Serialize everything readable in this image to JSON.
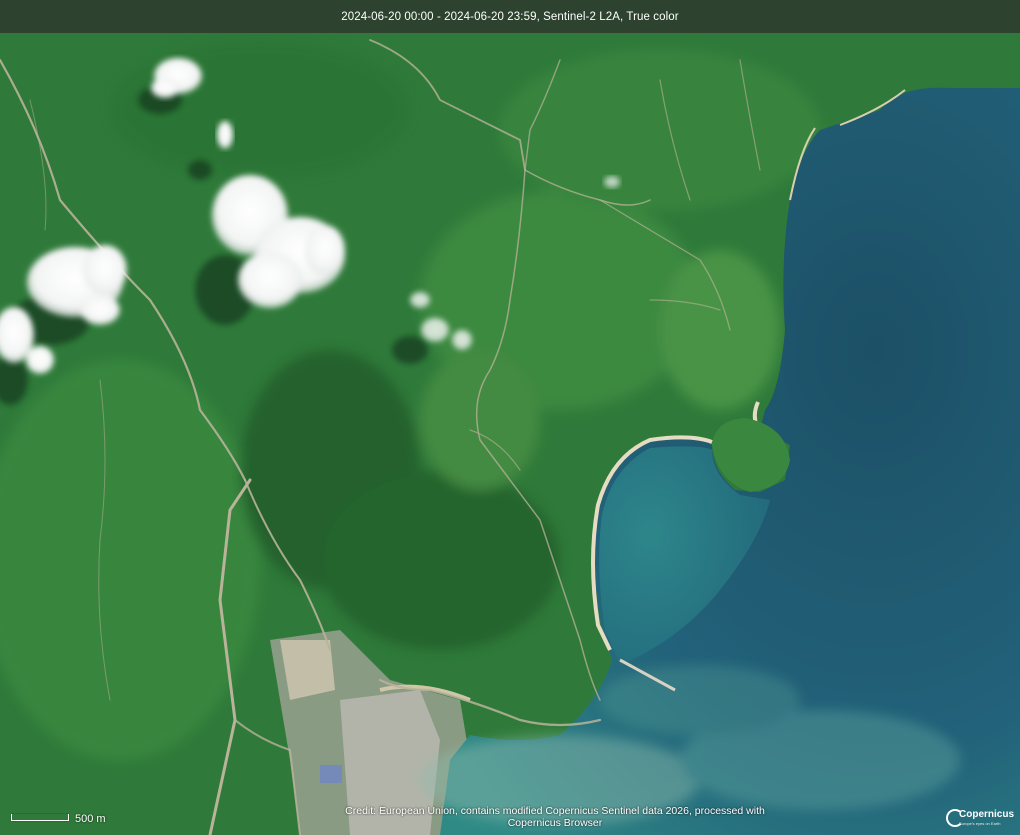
{
  "header": {
    "title": "2024-06-20 00:00 - 2024-06-20 23:59, Sentinel-2 L2A, True color"
  },
  "scale": {
    "label": "500 m"
  },
  "credit": {
    "line1": "Credit: European Union, contains modified Copernicus Sentinel data 2026, processed with",
    "line2": "Copernicus Browser"
  },
  "logo": {
    "text": "Copernicus",
    "sub": "Europe's eyes on Earth"
  },
  "colors": {
    "forest": "#2f7a3a",
    "forest_dark": "#245f2c",
    "forest_light": "#4a8f45",
    "sea_deep": "#1f5a6c",
    "sea_shallow": "#2a7e86",
    "sand": "#e6dcc2",
    "cloud": "#f4f6f5",
    "topbar": "#2d372d"
  }
}
